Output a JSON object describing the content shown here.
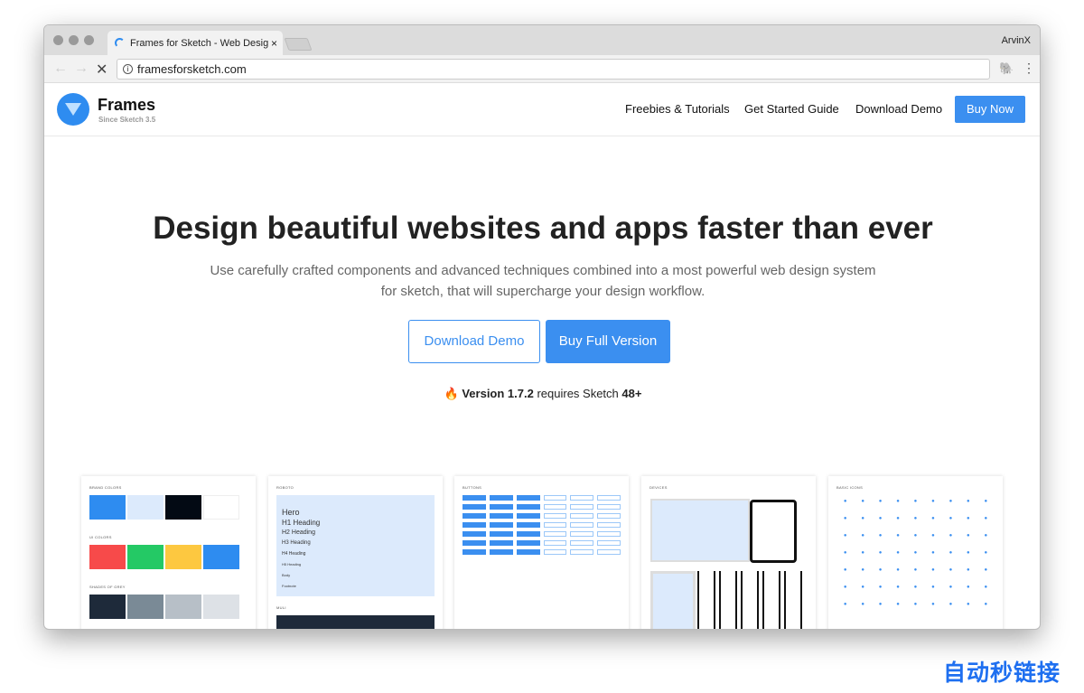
{
  "browser": {
    "tab_title": "Frames for Sketch - Web Design",
    "user": "ArvinX",
    "url": "framesforsketch.com"
  },
  "header": {
    "brand": "Frames",
    "tagline": "Since Sketch 3.5",
    "nav": [
      "Freebies & Tutorials",
      "Get Started Guide",
      "Download Demo"
    ],
    "buy": "Buy Now"
  },
  "hero": {
    "title": "Design beautiful websites and apps faster than ever",
    "subtitle": "Use carefully crafted components and advanced techniques combined into a most powerful web design system for sketch, that will supercharge your design workflow.",
    "download": "Download Demo",
    "buy_full": "Buy Full Version",
    "version_prefix": "Version 1.7.2",
    "version_mid": " requires Sketch ",
    "version_req": "48+"
  },
  "previews": {
    "colors": {
      "title": "BRAND COLORS",
      "brand": [
        "#2e8cf0",
        "#dceafc",
        "#030a14",
        "#ffffff"
      ],
      "ui_title": "UI COLORS",
      "ui": [
        "#f74a4a",
        "#24c965",
        "#fdc840",
        "#2e8cf0"
      ],
      "grey_title": "SHADES OF GREY",
      "grey": [
        "#1e2a3a",
        "#7a8a96",
        "#b7bfc7",
        "#dde1e6"
      ]
    },
    "typo": {
      "title": "ROBOTO",
      "rows": [
        "Hero",
        "H1 Heading",
        "H2 Heading",
        "H3 Heading",
        "H4 Heading",
        "H5 Heading",
        "Body",
        "Footnote"
      ],
      "title2": "MULI"
    },
    "buttons": {
      "title": "BUTTONS"
    },
    "devices": {
      "title": "DEVICES"
    },
    "icons": {
      "title": "BASIC ICONS"
    }
  },
  "watermark": "自动秒链接"
}
